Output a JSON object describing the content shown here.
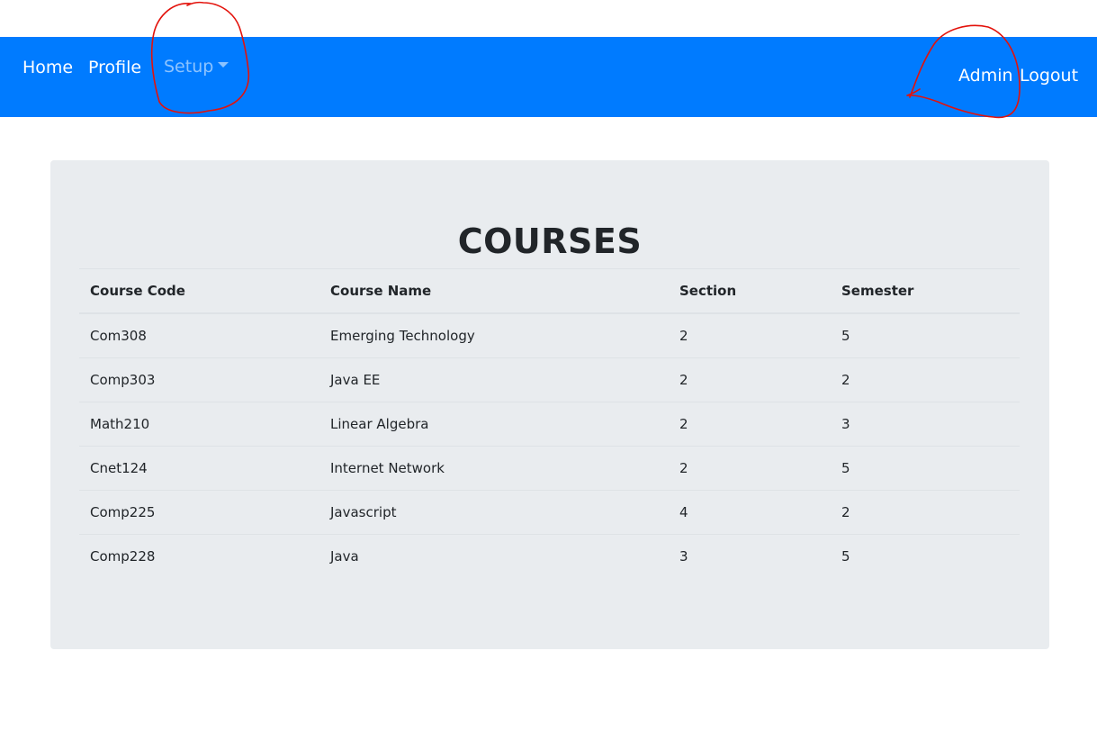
{
  "nav": {
    "home": "Home",
    "profile": "Profile",
    "setup": "Setup",
    "admin": "Admin",
    "logout": "Logout"
  },
  "content": {
    "title": "COURSES",
    "columns": [
      "Course Code",
      "Course Name",
      "Section",
      "Semester"
    ],
    "rows": [
      [
        "Com308",
        "Emerging Technology",
        "2",
        "5"
      ],
      [
        "Comp303",
        "Java EE",
        "2",
        "2"
      ],
      [
        "Math210",
        "Linear Algebra",
        "2",
        "3"
      ],
      [
        "Cnet124",
        "Internet Network",
        "2",
        "5"
      ],
      [
        "Comp225",
        "Javascript",
        "4",
        "2"
      ],
      [
        "Comp228",
        "Java",
        "3",
        "5"
      ]
    ]
  },
  "colors": {
    "navbar": "#007bff",
    "jumbotron": "#e9ecef",
    "annotation": "#e3120b"
  }
}
